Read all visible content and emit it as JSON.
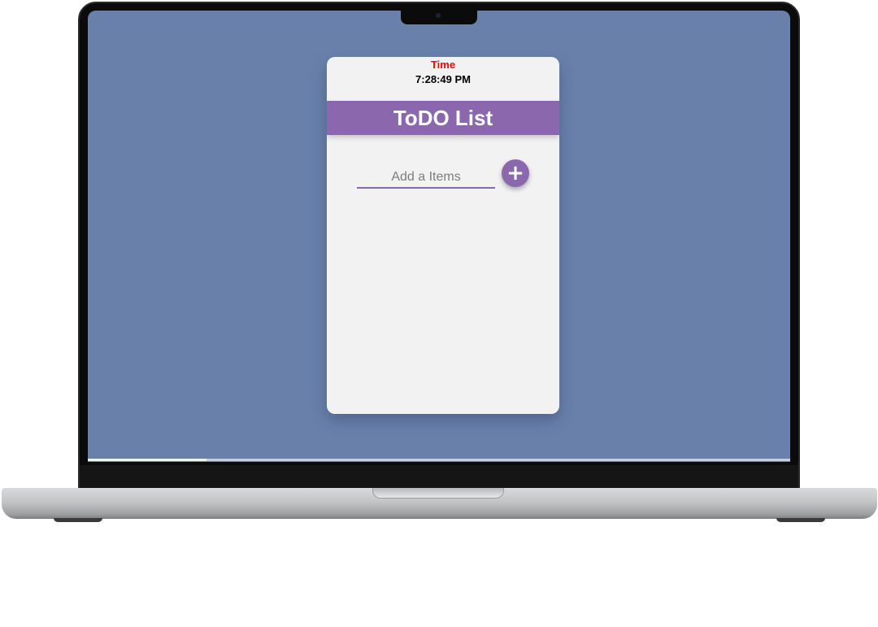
{
  "clock": {
    "label": "Time",
    "value": "7:28:49 PM"
  },
  "app": {
    "title": "ToDO List"
  },
  "input": {
    "placeholder": "Add a Items",
    "value": ""
  },
  "add_button": {
    "icon": "plus-icon",
    "symbol": "+"
  },
  "items": [],
  "colors": {
    "accent": "#8b68ad",
    "time_label": "#ff0000",
    "desktop": "#6981aa",
    "card": "#f2f2f3"
  }
}
